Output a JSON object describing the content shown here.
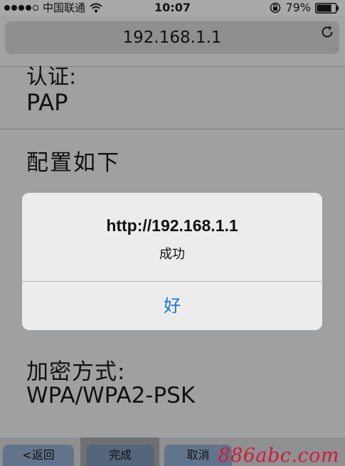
{
  "status_bar": {
    "carrier": "中国联通",
    "time": "10:07",
    "battery_percent": "79%",
    "battery_level": 0.79
  },
  "url_bar": {
    "url": "192.168.1.1"
  },
  "content": {
    "auth_label_partial": "认证:",
    "auth_value": "PAP",
    "config_label": "配置如下",
    "encryption_label": "加密方式:",
    "encryption_value": "WPA/WPA2-PSK"
  },
  "alert": {
    "title": "http://192.168.1.1",
    "message": "成功",
    "ok_label": "好"
  },
  "toolbar": {
    "back_label": "<返回",
    "done_label": "完成",
    "cancel_label": "取消"
  },
  "watermark": "886abc.com",
  "colors": {
    "alert_button": "#1a73d9",
    "watermark": "#d21b3a"
  }
}
